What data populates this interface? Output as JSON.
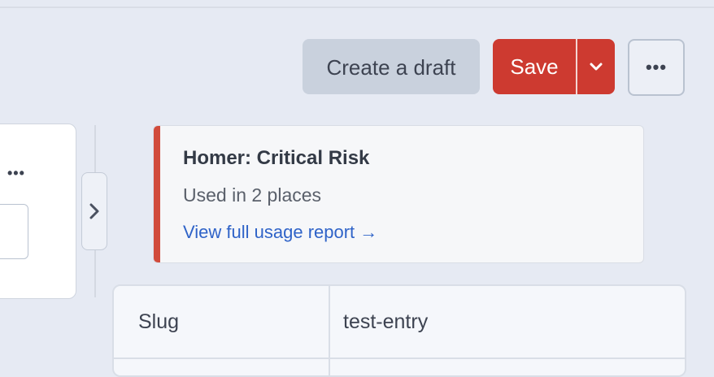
{
  "toolbar": {
    "create_draft_label": "Create a draft",
    "save_label": "Save",
    "more_label": "•••",
    "save_caret_icon": "chevron-down-icon",
    "more_icon": "ellipsis-icon"
  },
  "left_panel": {
    "menu_label": "•••",
    "toggle_icon": "chevron-right-icon"
  },
  "usage_card": {
    "title": "Homer: Critical Risk",
    "subtitle": "Used in 2 places",
    "link_label": "View full usage report →",
    "accent_color": "#d14b3b"
  },
  "meta_table": {
    "rows": [
      {
        "key": "Slug",
        "value": "test-entry"
      }
    ]
  },
  "colors": {
    "background": "#e6eaf3",
    "save": "#cd3a30",
    "draft": "#c9d1dd",
    "link": "#2f63c8"
  }
}
